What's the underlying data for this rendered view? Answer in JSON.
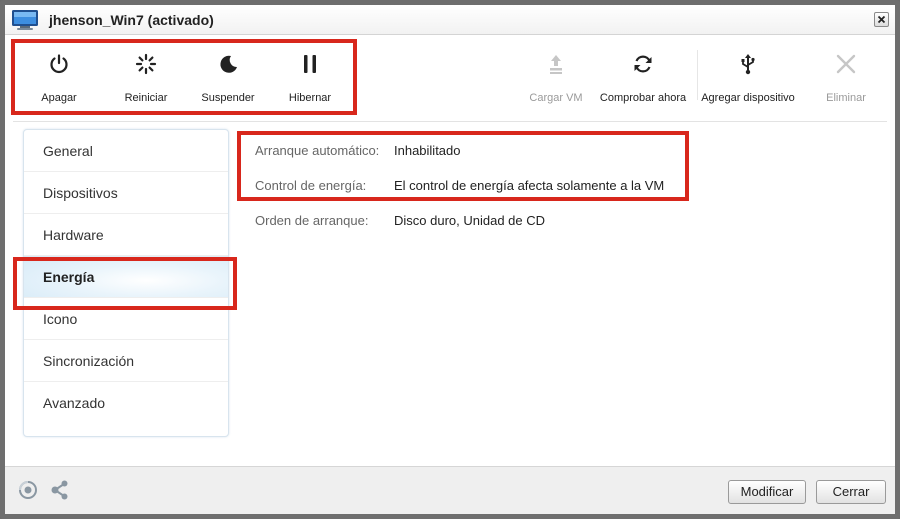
{
  "window": {
    "title": "jhenson_Win7 (activado)"
  },
  "toolbar": {
    "power_group": [
      {
        "label": "Apagar",
        "icon": "power-icon"
      },
      {
        "label": "Reiniciar",
        "icon": "spinner-icon"
      },
      {
        "label": "Suspender",
        "icon": "moon-icon"
      },
      {
        "label": "Hibernar",
        "icon": "pause-icon"
      }
    ],
    "actions": [
      {
        "label": "Cargar VM",
        "icon": "upload-icon",
        "enabled": false
      },
      {
        "label": "Comprobar ahora",
        "icon": "refresh-icon",
        "enabled": true
      },
      {
        "label": "Agregar dispositivo",
        "icon": "usb-icon",
        "enabled": true
      },
      {
        "label": "Eliminar",
        "icon": "x-icon",
        "enabled": false
      }
    ]
  },
  "sidebar": {
    "items": [
      {
        "label": "General"
      },
      {
        "label": "Dispositivos"
      },
      {
        "label": "Hardware"
      },
      {
        "label": "Energía",
        "active": true
      },
      {
        "label": "Icono"
      },
      {
        "label": "Sincronización"
      },
      {
        "label": "Avanzado"
      }
    ]
  },
  "details": {
    "rows": [
      {
        "label": "Arranque automático:",
        "value": "Inhabilitado"
      },
      {
        "label": "Control de energía:",
        "value": "El control de energía afecta solamente a la VM"
      },
      {
        "label": "Orden de arranque:",
        "value": "Disco duro, Unidad de CD"
      }
    ]
  },
  "footer": {
    "modify_label": "Modificar",
    "close_label": "Cerrar"
  },
  "colors": {
    "highlight": "#d8271c",
    "active_item_bg": "#d6eaf7"
  }
}
